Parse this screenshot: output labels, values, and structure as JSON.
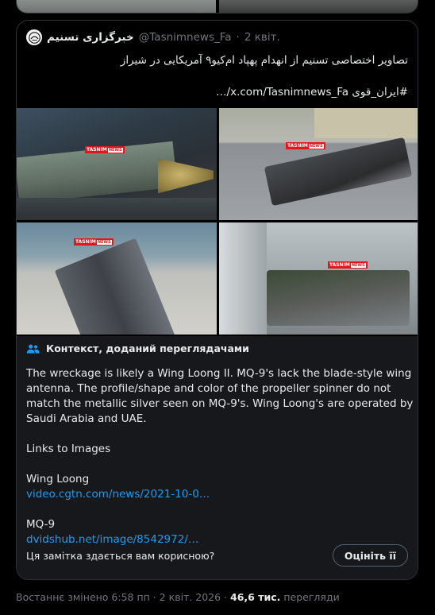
{
  "quoted_post": {
    "account_name": "خبرگزاری تسنیم",
    "handle": "@Tasnimnews_Fa",
    "separator": "·",
    "date": "2 квіт.",
    "text_line1": "تصاویر اختصاصی تسنیم از انهدام پهپاد ام‌کیو۹ آمریکایی در شیراز",
    "text_line2": "#ایران_قوی x.com/Tasnimnews_Fa/…"
  },
  "photos": [
    {
      "watermark": "TASNIM",
      "badge": "NEWS"
    },
    {
      "watermark": "TASNIM",
      "badge": "NEWS"
    },
    {
      "watermark": "TASNIM",
      "badge": "NEWS"
    },
    {
      "watermark": "TASNIM",
      "badge": "NEWS"
    }
  ],
  "community_note": {
    "title": "Контекст, доданий переглядачами",
    "paragraph1": "The wreckage is likely a Wing Loong II. MQ-9's lack the  blade-style wing antenna. The profile/shape and color of the propeller spinner do not match the metallic silver seen on MQ-9's. Wing Loong's are operated by Saudi Arabia and UAE.",
    "paragraph2": "Links to Images",
    "label1": "Wing Loong",
    "link1": "video.cgtn.com/news/2021-10-0…",
    "label2": "MQ-9",
    "link2": "dvidshub.net/image/8542972/…",
    "question": "Ця замітка здається вам корисною?",
    "rate_button": "Оцініть її"
  },
  "footer": {
    "edited": "Востаннє змінено 6:58 пп · 2 квіт. 2026 ·",
    "views_count": "46,6 тис.",
    "views_label": "перегляди"
  },
  "icons": {
    "avatar": "tasnim-logo-icon",
    "notes": "people-icon"
  },
  "colors": {
    "background": "#000000",
    "link": "#1d9bf0",
    "muted": "#71767b",
    "notes_background": "#16181c"
  }
}
